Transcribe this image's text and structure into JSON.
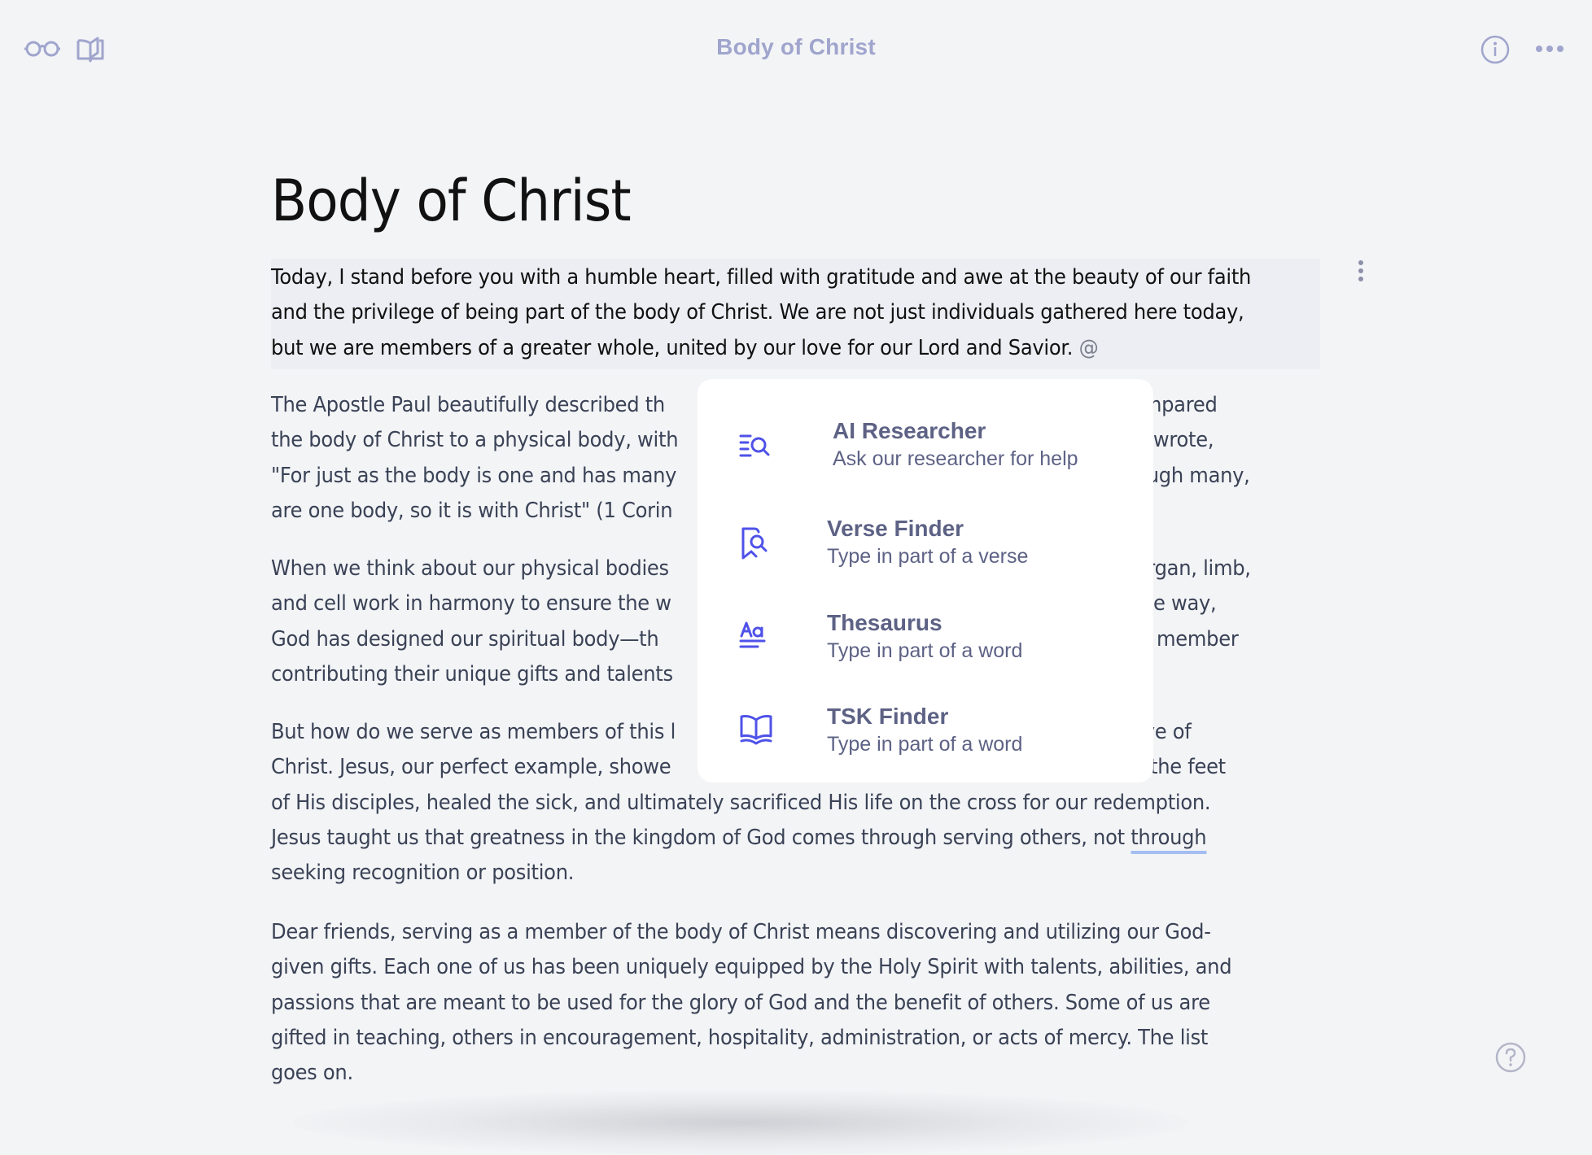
{
  "topbar": {
    "title": "Body of Christ",
    "left_icons": [
      "glasses-icon",
      "open-book-icon"
    ],
    "right_icons": [
      "info-icon",
      "more-horizontal-icon"
    ]
  },
  "document": {
    "title": "Body of Christ",
    "paragraphs": [
      {
        "lines": [
          "Today, I stand before you with a humble heart, filled with gratitude and awe at the beauty of our faith",
          "and the privilege of being part of the body of Christ. We are not just individuals gathered here today,",
          "but we are members of a greater whole, united by our love for our Lord and Savior."
        ],
        "trailing_mention": "@"
      },
      {
        "lines": [
          {
            "left": "The Apostle Paul beautifully described th",
            "right": "he compared"
          },
          {
            "left": "the body of Christ to a physical body, with",
            "right": "le. He wrote,"
          },
          {
            "left": "\"For just as the body is one and has many",
            "right": "y, though many,"
          },
          {
            "left": "are one body, so it is with Christ\" (1 Corin",
            "right": ""
          }
        ]
      },
      {
        "lines": [
          {
            "left": "When we think about our physical bodies",
            "right": "ach organ, limb,"
          },
          {
            "left": "and cell work in harmony to ensure the w",
            "right": "e same way,"
          },
          {
            "left": "God has designed our spiritual body—th",
            "right": "every member"
          },
          {
            "left": "contributing their unique gifts and talents",
            "right": ""
          }
        ]
      },
      {
        "lines": [
          {
            "left": "But how do we serve as members of this l",
            "right": "he love of"
          },
          {
            "left": "Christ. Jesus, our perfect example, showe",
            "right": "shed the feet"
          },
          "of His disciples, healed the sick, and ultimately sacrificed His life on the cross for our redemption.",
          "Jesus taught us that greatness in the kingdom of God comes through serving others, not ",
          "seeking recognition or position."
        ],
        "underlined_word": "through"
      },
      {
        "lines": [
          "Dear friends, serving as a member of the body of Christ means discovering and utilizing our God-",
          "given gifts. Each one of us has been uniquely equipped by the Holy Spirit with talents, abilities, and",
          "passions that are meant to be used for the glory of God and the benefit of others. Some of us are",
          "gifted in teaching, others in encouragement, hospitality, administration, or acts of mercy. The list",
          "goes on."
        ]
      }
    ]
  },
  "popup_menu": {
    "items": [
      {
        "icon": "list-search-icon",
        "title": "AI Researcher",
        "subtitle": "Ask our researcher for help"
      },
      {
        "icon": "bookmark-search-icon",
        "title": "Verse Finder",
        "subtitle": "Type in part of a verse"
      },
      {
        "icon": "text-format-icon",
        "title": "Thesaurus",
        "subtitle": "Type in part of a word"
      },
      {
        "icon": "book-open-icon",
        "title": "TSK Finder",
        "subtitle": "Type in part of a word"
      }
    ]
  },
  "help": {
    "icon": "help-circle-icon"
  },
  "colors": {
    "background": "#f3f4f6",
    "topbar_icon": "#a0a5cd",
    "popup_icon_accent": "#4f52e8",
    "popup_text": "#5d6285",
    "body_text": "#3a4256",
    "underline": "#a4bef2"
  }
}
